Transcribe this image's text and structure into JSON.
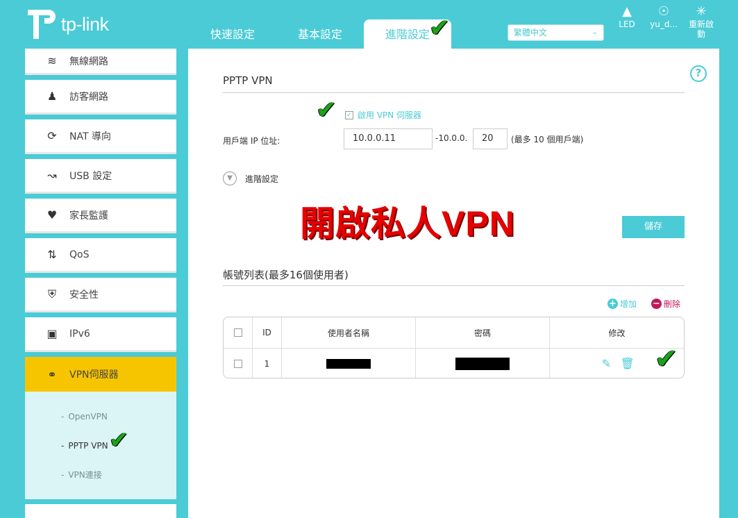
{
  "brand": {
    "logo_text": "tp-link"
  },
  "nav_tabs": [
    {
      "label": "快速設定"
    },
    {
      "label": "基本設定"
    },
    {
      "label": "進階設定"
    }
  ],
  "language": {
    "selected": "繁體中文"
  },
  "top_icons": [
    {
      "label": "LED",
      "icon": "bulb-icon"
    },
    {
      "label": "yu_d...",
      "icon": "user-icon"
    },
    {
      "label": "重新啟動",
      "icon": "reboot-icon"
    }
  ],
  "sidebar": {
    "items": [
      {
        "label": "無線網路",
        "icon": "wireless-icon"
      },
      {
        "label": "訪客網路",
        "icon": "guest-icon"
      },
      {
        "label": "NAT 導向",
        "icon": "nat-icon"
      },
      {
        "label": "USB 設定",
        "icon": "usb-icon"
      },
      {
        "label": "家長監護",
        "icon": "parental-icon"
      },
      {
        "label": "QoS",
        "icon": "qos-icon"
      },
      {
        "label": "安全性",
        "icon": "shield-icon"
      },
      {
        "label": "IPv6",
        "icon": "ipv6-icon"
      },
      {
        "label": "VPN伺服器",
        "icon": "link-icon"
      }
    ],
    "submenu": [
      {
        "label": "OpenVPN"
      },
      {
        "label": "PPTP VPN"
      },
      {
        "label": "VPN連接"
      }
    ]
  },
  "main": {
    "section_title": "PPTP VPN",
    "enable_label": "啟用 VPN 伺服器",
    "enabled": true,
    "ip_label": "用戶端 IP 位址:",
    "ip_start": "10.0.0.11",
    "ip_mid": "-10.0.0.",
    "ip_end": "20",
    "ip_note": "(最多 10 個用戶端)",
    "advanced_label": "進階設定",
    "banner": "開啟私人VPN",
    "save_label": "儲存",
    "accounts_title": "帳號列表(最多16個使用者)",
    "add_label": "增加",
    "delete_label": "刪除",
    "table": {
      "headers": [
        "ID",
        "使用者名稱",
        "密碼",
        "修改"
      ],
      "rows": [
        {
          "id": "1"
        }
      ]
    }
  },
  "colors": {
    "accent": "#4acbd6",
    "active": "#f7c500",
    "danger": "#e60000",
    "delete": "#c2185b"
  }
}
